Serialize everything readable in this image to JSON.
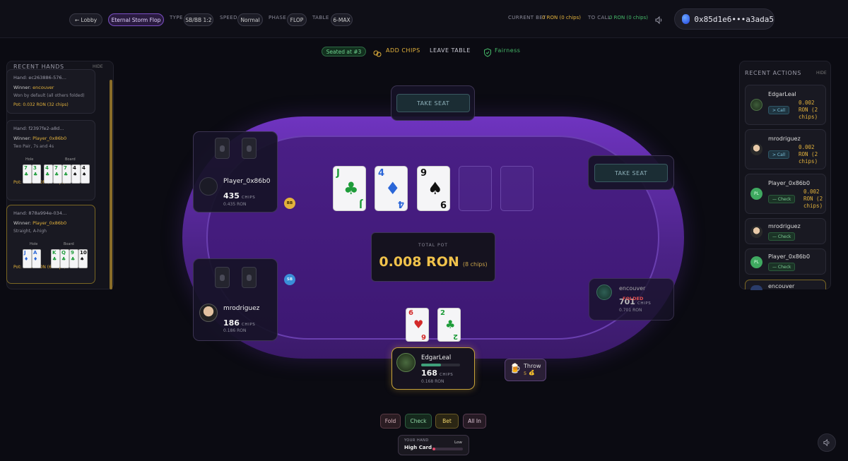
{
  "header": {
    "lobby_label": "← Lobby",
    "table_name": "Eternal Storm Flop",
    "type_label": "TYPE",
    "type_value": "SB/BB 1:2",
    "speed_label": "SPEED",
    "speed_value": "Normal",
    "phase_label": "PHASE",
    "phase_value": "FLOP",
    "table_label": "TABLE",
    "table_value": "6-MAX",
    "current_bet_label": "CURRENT BET",
    "current_bet_value": "0 RON (0 chips)",
    "to_call_label": "TO CALL",
    "to_call_value": "0 RON (0 chips)",
    "wallet": "0x85d1e6•••a3ada5"
  },
  "subbar": {
    "seated": "Seated at #3",
    "add_chips": "ADD CHIPS",
    "leave_table": "LEAVE TABLE",
    "fairness": "Fairness"
  },
  "recent_hands": {
    "title": "RECENT HANDS",
    "hide": "HIDE",
    "hands": [
      {
        "id": "Hand: ec263886-576…",
        "winner_prefix": "Winner: ",
        "winner": "encouver",
        "desc": "Won by default (all others folded)",
        "pot": "Pot: 0.032 RON (32 chips)"
      },
      {
        "id": "Hand: f2397fe2-a8d…",
        "winner_prefix": "Winner: ",
        "winner": "Player_0x86b0",
        "desc": "Two Pair, 7s and 4s",
        "pot": "Pot: 0.008 RON (8 chips)",
        "hole_label": "Hole",
        "board_label": "Board"
      },
      {
        "id": "Hand: 878a994e-034…",
        "winner_prefix": "Winner: ",
        "winner": "Player_0x86b0",
        "desc": "Straight, A-high",
        "pot": "Pot: 0.006 RON (6 chips)",
        "hole_label": "Hole",
        "board_label": "Board"
      }
    ]
  },
  "recent_actions": {
    "title": "RECENT ACTIONS",
    "hide": "HIDE",
    "items": [
      {
        "name": "EdgarLeal",
        "action": "> Call",
        "amount": "0.002 RON (2 chips)"
      },
      {
        "name": "mrodriguez",
        "action": "> Call",
        "amount": "0.002 RON (2 chips)"
      },
      {
        "name": "Player_0x86b0",
        "initials": "PL",
        "action": "— Check",
        "amount": "0.002 RON (2 chips)"
      },
      {
        "name": "mrodriguez",
        "action": "— Check",
        "amount": ""
      },
      {
        "name": "Player_0x86b0",
        "initials": "PL",
        "action": "— Check",
        "amount": ""
      },
      {
        "name": "encouver",
        "action": "",
        "amount": ""
      }
    ]
  },
  "table": {
    "take_seat_top": "TAKE SEAT",
    "take_seat_right": "TAKE SEAT",
    "pot_label": "TOTAL POT",
    "pot_value": "0.008 RON",
    "pot_chips": "(8 chips)",
    "bb_marker": "BB",
    "sb_marker": "SB",
    "board": [
      {
        "rank": "J",
        "suit": "♣",
        "color": "#1e9c3a"
      },
      {
        "rank": "4",
        "suit": "♦",
        "color": "#2a66d8"
      },
      {
        "rank": "9",
        "suit": "♠",
        "color": "#111111"
      }
    ],
    "players": {
      "p1": {
        "name": "Player_0x86b0",
        "chips": "435",
        "chips_label": "CHIPS",
        "ron": "0.435 RON"
      },
      "p2": {
        "name": "mrodriguez",
        "chips": "186",
        "chips_label": "CHIPS",
        "ron": "0.186 RON"
      },
      "p3": {
        "name": "encouver",
        "chips": "701",
        "chips_label": "CHIPS",
        "ron": "0.701 RON",
        "status": "FOLDED"
      },
      "me": {
        "name": "EdgarLeal",
        "chips": "168",
        "chips_label": "CHIPS",
        "ron": "0.168 RON",
        "cards": [
          {
            "rank": "6",
            "suit": "♥",
            "color": "#d32a2a"
          },
          {
            "rank": "2",
            "suit": "♣",
            "color": "#1e9c3a"
          }
        ]
      }
    },
    "throw": {
      "label": "Throw",
      "cost": "5"
    }
  },
  "actions": {
    "fold": "Fold",
    "check": "Check",
    "bet": "Bet",
    "all_in": "All In"
  },
  "your_hand": {
    "label": "YOUR HAND",
    "value": "High Card",
    "strength": "Low",
    "strength_fraction": 0.1
  },
  "colors": {
    "accent_gold": "#e3b23c",
    "felt_purple": "#4a1f86",
    "green": "#45b868"
  }
}
